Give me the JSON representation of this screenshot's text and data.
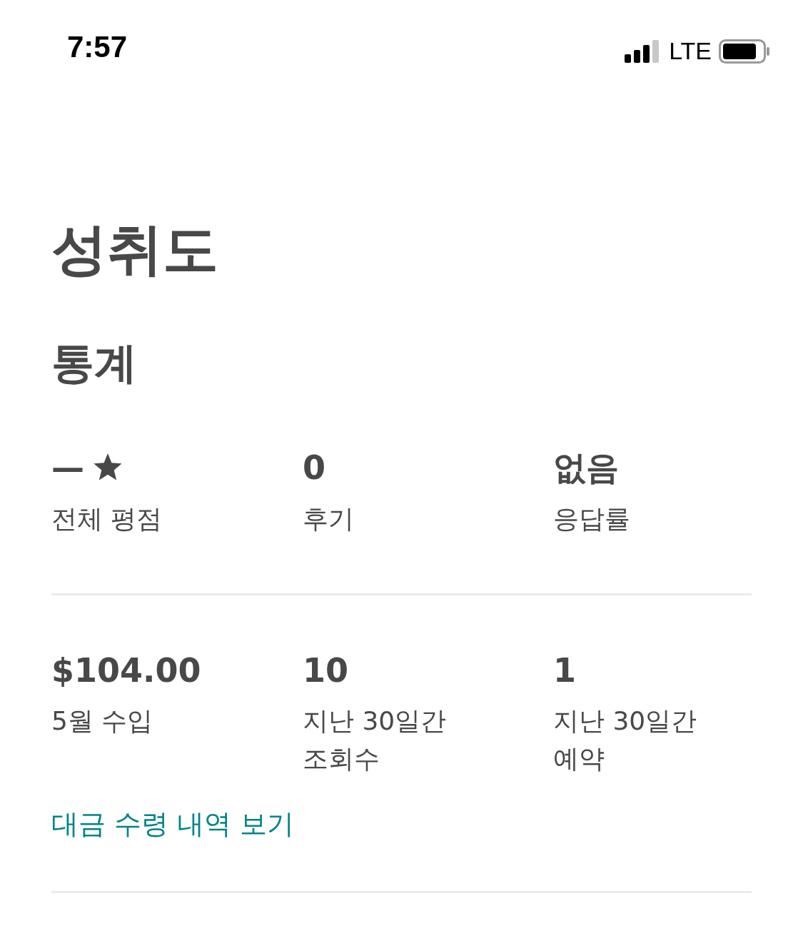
{
  "status_bar": {
    "time": "7:57",
    "network": "LTE"
  },
  "title": "성취도",
  "section_title": "통계",
  "stat_rows": [
    {
      "stats": [
        {
          "value": "—",
          "kind": "rating",
          "label": "전체 평점"
        },
        {
          "value": "0",
          "kind": "plain",
          "label": "후기"
        },
        {
          "value": "없음",
          "kind": "plain",
          "label": "응답률"
        }
      ]
    },
    {
      "stats": [
        {
          "value": "$104.00",
          "kind": "plain",
          "label": "5월 수입"
        },
        {
          "value": "10",
          "kind": "plain",
          "label": "지난 30일간 조회수"
        },
        {
          "value": "1",
          "kind": "plain",
          "label": "지난 30일간 예약"
        }
      ],
      "link": "대금 수령 내역 보기"
    }
  ]
}
